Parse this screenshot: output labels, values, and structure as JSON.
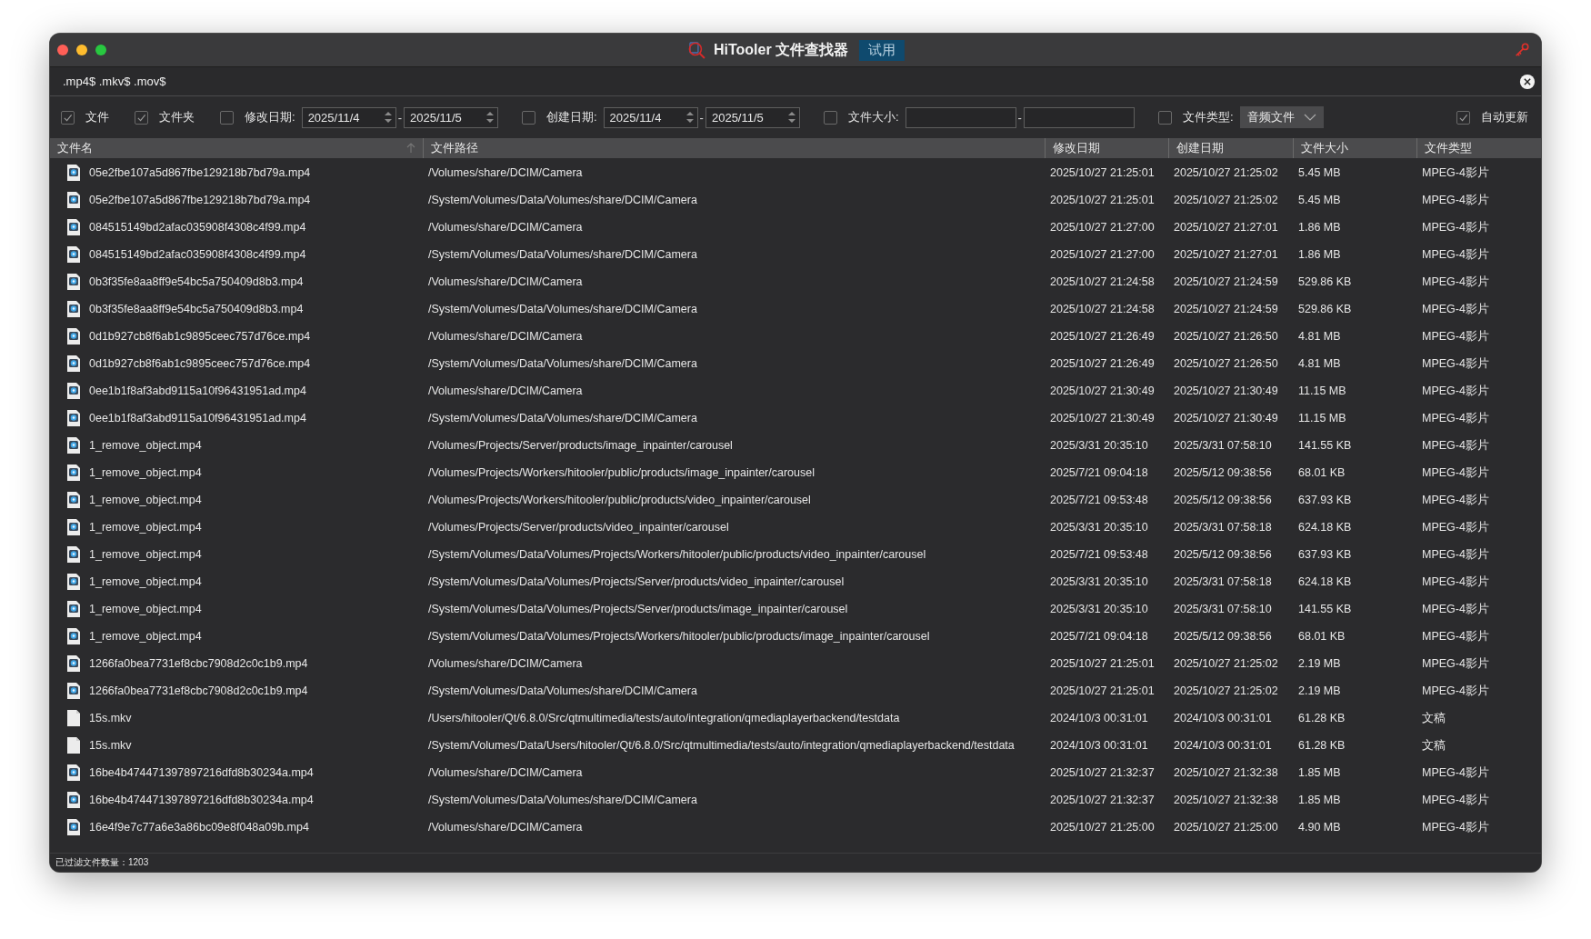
{
  "window": {
    "title": "HiTooler 文件查找器",
    "badge": "试用"
  },
  "search": {
    "value": ".mp4$ .mkv$ .mov$"
  },
  "filters": [
    {
      "kind": "check",
      "label": "文件",
      "checked": true
    },
    {
      "kind": "check",
      "label": "文件夹",
      "checked": true
    },
    {
      "kind": "daterange",
      "label": "修改日期:",
      "checked": false,
      "from": "2025/11/4",
      "separator": "-",
      "to": "2025/11/5"
    },
    {
      "kind": "daterange",
      "label": "创建日期:",
      "checked": false,
      "from": "2025/11/4",
      "separator": "-",
      "to": "2025/11/5"
    },
    {
      "kind": "sizerange",
      "label": "文件大小:",
      "checked": false,
      "separator": "-"
    },
    {
      "kind": "select",
      "label": "文件类型:",
      "checked": false,
      "value": "音频文件"
    }
  ],
  "auto_update": {
    "label": "自动更新",
    "checked": true
  },
  "table": {
    "columns": [
      {
        "label": "文件名",
        "sorted": true
      },
      {
        "label": "文件路径",
        "sorted": false
      },
      {
        "label": "修改日期",
        "sorted": false
      },
      {
        "label": "创建日期",
        "sorted": false
      },
      {
        "label": "文件大小",
        "sorted": false
      },
      {
        "label": "文件类型",
        "sorted": false
      }
    ],
    "rows": [
      {
        "kind": "video",
        "name": "05e2fbe107a5d867fbe129218b7bd79a.mp4",
        "path": "/Volumes/share/DCIM/Camera",
        "modified": "2025/10/27 21:25:01",
        "created": "2025/10/27 21:25:02",
        "size": "5.45 MB",
        "type": "MPEG-4影片"
      },
      {
        "kind": "video",
        "name": "05e2fbe107a5d867fbe129218b7bd79a.mp4",
        "path": "/System/Volumes/Data/Volumes/share/DCIM/Camera",
        "modified": "2025/10/27 21:25:01",
        "created": "2025/10/27 21:25:02",
        "size": "5.45 MB",
        "type": "MPEG-4影片"
      },
      {
        "kind": "video",
        "name": "084515149bd2afac035908f4308c4f99.mp4",
        "path": "/Volumes/share/DCIM/Camera",
        "modified": "2025/10/27 21:27:00",
        "created": "2025/10/27 21:27:01",
        "size": "1.86 MB",
        "type": "MPEG-4影片"
      },
      {
        "kind": "video",
        "name": "084515149bd2afac035908f4308c4f99.mp4",
        "path": "/System/Volumes/Data/Volumes/share/DCIM/Camera",
        "modified": "2025/10/27 21:27:00",
        "created": "2025/10/27 21:27:01",
        "size": "1.86 MB",
        "type": "MPEG-4影片"
      },
      {
        "kind": "video",
        "name": "0b3f35fe8aa8ff9e54bc5a750409d8b3.mp4",
        "path": "/Volumes/share/DCIM/Camera",
        "modified": "2025/10/27 21:24:58",
        "created": "2025/10/27 21:24:59",
        "size": "529.86 KB",
        "type": "MPEG-4影片"
      },
      {
        "kind": "video",
        "name": "0b3f35fe8aa8ff9e54bc5a750409d8b3.mp4",
        "path": "/System/Volumes/Data/Volumes/share/DCIM/Camera",
        "modified": "2025/10/27 21:24:58",
        "created": "2025/10/27 21:24:59",
        "size": "529.86 KB",
        "type": "MPEG-4影片"
      },
      {
        "kind": "video",
        "name": "0d1b927cb8f6ab1c9895ceec757d76ce.mp4",
        "path": "/Volumes/share/DCIM/Camera",
        "modified": "2025/10/27 21:26:49",
        "created": "2025/10/27 21:26:50",
        "size": "4.81 MB",
        "type": "MPEG-4影片"
      },
      {
        "kind": "video",
        "name": "0d1b927cb8f6ab1c9895ceec757d76ce.mp4",
        "path": "/System/Volumes/Data/Volumes/share/DCIM/Camera",
        "modified": "2025/10/27 21:26:49",
        "created": "2025/10/27 21:26:50",
        "size": "4.81 MB",
        "type": "MPEG-4影片"
      },
      {
        "kind": "video",
        "name": "0ee1b1f8af3abd9115a10f96431951ad.mp4",
        "path": "/Volumes/share/DCIM/Camera",
        "modified": "2025/10/27 21:30:49",
        "created": "2025/10/27 21:30:49",
        "size": "11.15 MB",
        "type": "MPEG-4影片"
      },
      {
        "kind": "video",
        "name": "0ee1b1f8af3abd9115a10f96431951ad.mp4",
        "path": "/System/Volumes/Data/Volumes/share/DCIM/Camera",
        "modified": "2025/10/27 21:30:49",
        "created": "2025/10/27 21:30:49",
        "size": "11.15 MB",
        "type": "MPEG-4影片"
      },
      {
        "kind": "video",
        "name": "1_remove_object.mp4",
        "path": "/Volumes/Projects/Server/products/image_inpainter/carousel",
        "modified": "2025/3/31 20:35:10",
        "created": "2025/3/31 07:58:10",
        "size": "141.55 KB",
        "type": "MPEG-4影片"
      },
      {
        "kind": "video",
        "name": "1_remove_object.mp4",
        "path": "/Volumes/Projects/Workers/hitooler/public/products/image_inpainter/carousel",
        "modified": "2025/7/21 09:04:18",
        "created": "2025/5/12 09:38:56",
        "size": "68.01 KB",
        "type": "MPEG-4影片"
      },
      {
        "kind": "video",
        "name": "1_remove_object.mp4",
        "path": "/Volumes/Projects/Workers/hitooler/public/products/video_inpainter/carousel",
        "modified": "2025/7/21 09:53:48",
        "created": "2025/5/12 09:38:56",
        "size": "637.93 KB",
        "type": "MPEG-4影片"
      },
      {
        "kind": "video",
        "name": "1_remove_object.mp4",
        "path": "/Volumes/Projects/Server/products/video_inpainter/carousel",
        "modified": "2025/3/31 20:35:10",
        "created": "2025/3/31 07:58:18",
        "size": "624.18 KB",
        "type": "MPEG-4影片"
      },
      {
        "kind": "video",
        "name": "1_remove_object.mp4",
        "path": "/System/Volumes/Data/Volumes/Projects/Workers/hitooler/public/products/video_inpainter/carousel",
        "modified": "2025/7/21 09:53:48",
        "created": "2025/5/12 09:38:56",
        "size": "637.93 KB",
        "type": "MPEG-4影片"
      },
      {
        "kind": "video",
        "name": "1_remove_object.mp4",
        "path": "/System/Volumes/Data/Volumes/Projects/Server/products/video_inpainter/carousel",
        "modified": "2025/3/31 20:35:10",
        "created": "2025/3/31 07:58:18",
        "size": "624.18 KB",
        "type": "MPEG-4影片"
      },
      {
        "kind": "video",
        "name": "1_remove_object.mp4",
        "path": "/System/Volumes/Data/Volumes/Projects/Server/products/image_inpainter/carousel",
        "modified": "2025/3/31 20:35:10",
        "created": "2025/3/31 07:58:10",
        "size": "141.55 KB",
        "type": "MPEG-4影片"
      },
      {
        "kind": "video",
        "name": "1_remove_object.mp4",
        "path": "/System/Volumes/Data/Volumes/Projects/Workers/hitooler/public/products/image_inpainter/carousel",
        "modified": "2025/7/21 09:04:18",
        "created": "2025/5/12 09:38:56",
        "size": "68.01 KB",
        "type": "MPEG-4影片"
      },
      {
        "kind": "video",
        "name": "1266fa0bea7731ef8cbc7908d2c0c1b9.mp4",
        "path": "/Volumes/share/DCIM/Camera",
        "modified": "2025/10/27 21:25:01",
        "created": "2025/10/27 21:25:02",
        "size": "2.19 MB",
        "type": "MPEG-4影片"
      },
      {
        "kind": "video",
        "name": "1266fa0bea7731ef8cbc7908d2c0c1b9.mp4",
        "path": "/System/Volumes/Data/Volumes/share/DCIM/Camera",
        "modified": "2025/10/27 21:25:01",
        "created": "2025/10/27 21:25:02",
        "size": "2.19 MB",
        "type": "MPEG-4影片"
      },
      {
        "kind": "document",
        "name": "15s.mkv",
        "path": "/Users/hitooler/Qt/6.8.0/Src/qtmultimedia/tests/auto/integration/qmediaplayerbackend/testdata",
        "modified": "2024/10/3 00:31:01",
        "created": "2024/10/3 00:31:01",
        "size": "61.28 KB",
        "type": "文稿"
      },
      {
        "kind": "document",
        "name": "15s.mkv",
        "path": "/System/Volumes/Data/Users/hitooler/Qt/6.8.0/Src/qtmultimedia/tests/auto/integration/qmediaplayerbackend/testdata",
        "modified": "2024/10/3 00:31:01",
        "created": "2024/10/3 00:31:01",
        "size": "61.28 KB",
        "type": "文稿"
      },
      {
        "kind": "video",
        "name": "16be4b474471397897216dfd8b30234a.mp4",
        "path": "/Volumes/share/DCIM/Camera",
        "modified": "2025/10/27 21:32:37",
        "created": "2025/10/27 21:32:38",
        "size": "1.85 MB",
        "type": "MPEG-4影片"
      },
      {
        "kind": "video",
        "name": "16be4b474471397897216dfd8b30234a.mp4",
        "path": "/System/Volumes/Data/Volumes/share/DCIM/Camera",
        "modified": "2025/10/27 21:32:37",
        "created": "2025/10/27 21:32:38",
        "size": "1.85 MB",
        "type": "MPEG-4影片"
      },
      {
        "kind": "video",
        "name": "16e4f9e7c77a6e3a86bc09e8f048a09b.mp4",
        "path": "/Volumes/share/DCIM/Camera",
        "modified": "2025/10/27 21:25:00",
        "created": "2025/10/27 21:25:00",
        "size": "4.90 MB",
        "type": "MPEG-4影片"
      }
    ]
  },
  "status_bar": {
    "text": "已过滤文件数量：1203"
  }
}
